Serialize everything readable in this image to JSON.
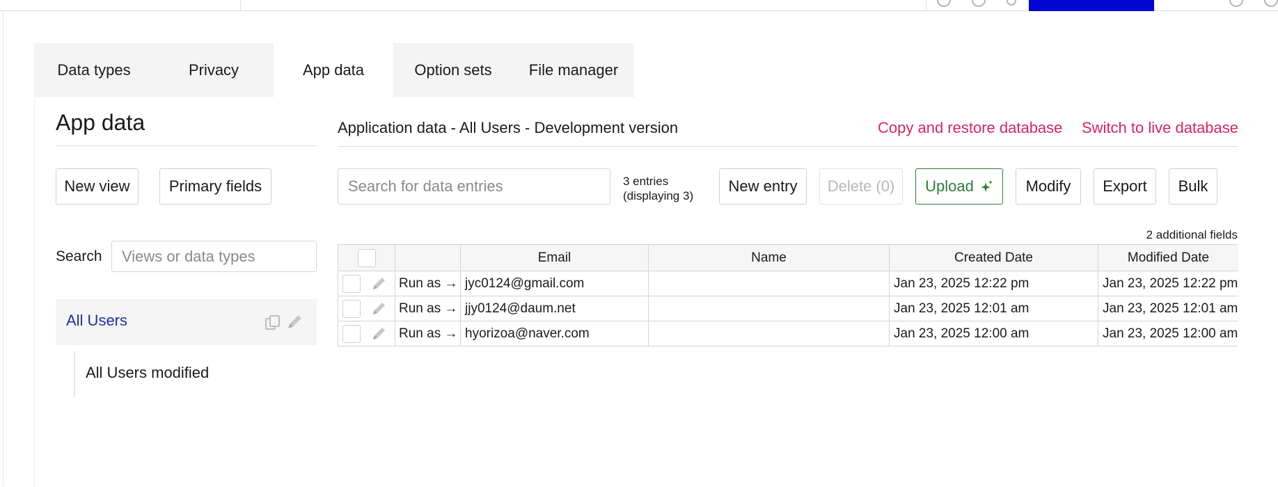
{
  "tabs": [
    {
      "label": "Data types"
    },
    {
      "label": "Privacy"
    },
    {
      "label": "App data",
      "active": true
    },
    {
      "label": "Option sets"
    },
    {
      "label": "File manager"
    }
  ],
  "left": {
    "title": "App data",
    "new_view_label": "New view",
    "primary_fields_label": "Primary fields",
    "search_label": "Search",
    "search_placeholder": "Views or data types",
    "views": [
      {
        "label": "All Users",
        "selected": true
      },
      {
        "label": "All Users modified"
      }
    ]
  },
  "main": {
    "heading": "Application data - All Users - Development version",
    "copy_restore_label": "Copy and restore database",
    "switch_live_label": "Switch to live database",
    "search_placeholder": "Search for data entries",
    "entries_count": "3 entries",
    "entries_displaying": "(displaying 3)",
    "buttons": {
      "new_entry": "New entry",
      "delete": "Delete (0)",
      "upload": "Upload",
      "modify": "Modify",
      "export": "Export",
      "bulk": "Bulk"
    },
    "additional_fields": "2 additional fields",
    "table": {
      "columns": [
        "Email",
        "Name",
        "Created Date",
        "Modified Date"
      ],
      "run_as_label": "Run as →",
      "rows": [
        {
          "email": "jyc0124@gmail.com",
          "name": "",
          "created": "Jan 23, 2025 12:22 pm",
          "modified": "Jan 23, 2025 12:22 pm"
        },
        {
          "email": "jjy0124@daum.net",
          "name": "",
          "created": "Jan 23, 2025 12:01 am",
          "modified": "Jan 23, 2025 12:01 am"
        },
        {
          "email": "hyorizoa@naver.com",
          "name": "",
          "created": "Jan 23, 2025 12:00 am",
          "modified": "Jan 23, 2025 12:00 am"
        }
      ]
    }
  },
  "colors": {
    "link": "#d6275c",
    "selected_view": "#1f2ea8",
    "upload": "#2e7d32",
    "topbar_accent": "#0205d3"
  },
  "icons": [
    "copy-icon",
    "pencil-icon",
    "sparkle-icon",
    "checkbox"
  ]
}
